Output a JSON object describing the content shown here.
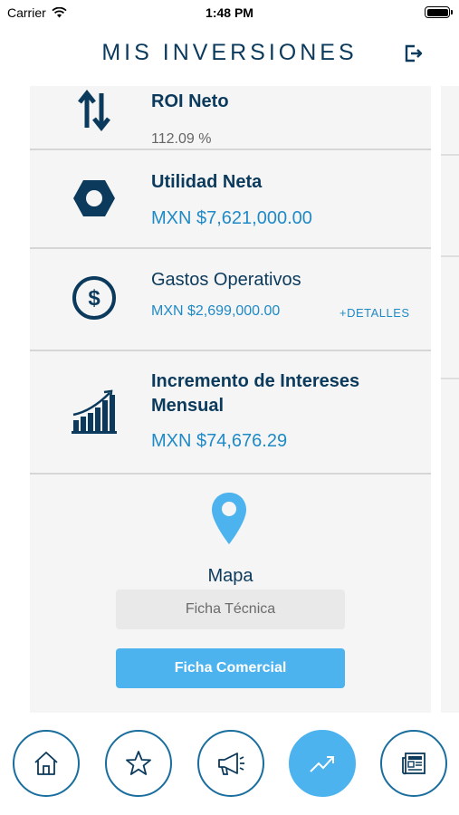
{
  "status_bar": {
    "carrier": "Carrier",
    "time": "1:48 PM"
  },
  "header": {
    "title": "MIS INVERSIONES"
  },
  "metrics": [
    {
      "title": "ROI Neto",
      "value": "112.09 %",
      "icon": "arrows-up-down-icon"
    },
    {
      "title": "Utilidad Neta",
      "value": "MXN $7,621,000.00",
      "icon": "hexagon-nut-icon"
    },
    {
      "title": "Gastos Operativos",
      "value": "MXN $2,699,000.00",
      "details_label": "+DETALLES",
      "icon": "dollar-circle-icon"
    },
    {
      "title_line1": "Incremento de Intereses",
      "title_line2": "Mensual",
      "value": "MXN $74,676.29",
      "icon": "bar-chart-growth-icon"
    }
  ],
  "map": {
    "label": "Mapa",
    "icon": "map-pin-icon"
  },
  "buttons": {
    "ficha_tecnica": "Ficha Técnica",
    "ficha_comercial": "Ficha Comercial"
  },
  "bottom_nav": [
    {
      "icon": "home-icon",
      "active": false
    },
    {
      "icon": "star-icon",
      "active": false
    },
    {
      "icon": "megaphone-icon",
      "active": false
    },
    {
      "icon": "trending-up-icon",
      "active": true
    },
    {
      "icon": "newspaper-icon",
      "active": false
    }
  ],
  "colors": {
    "primary_dark": "#0b3a5c",
    "accent_blue": "#4db3ef",
    "value_blue": "#1f8ac6",
    "panel_bg": "#f5f5f5"
  }
}
